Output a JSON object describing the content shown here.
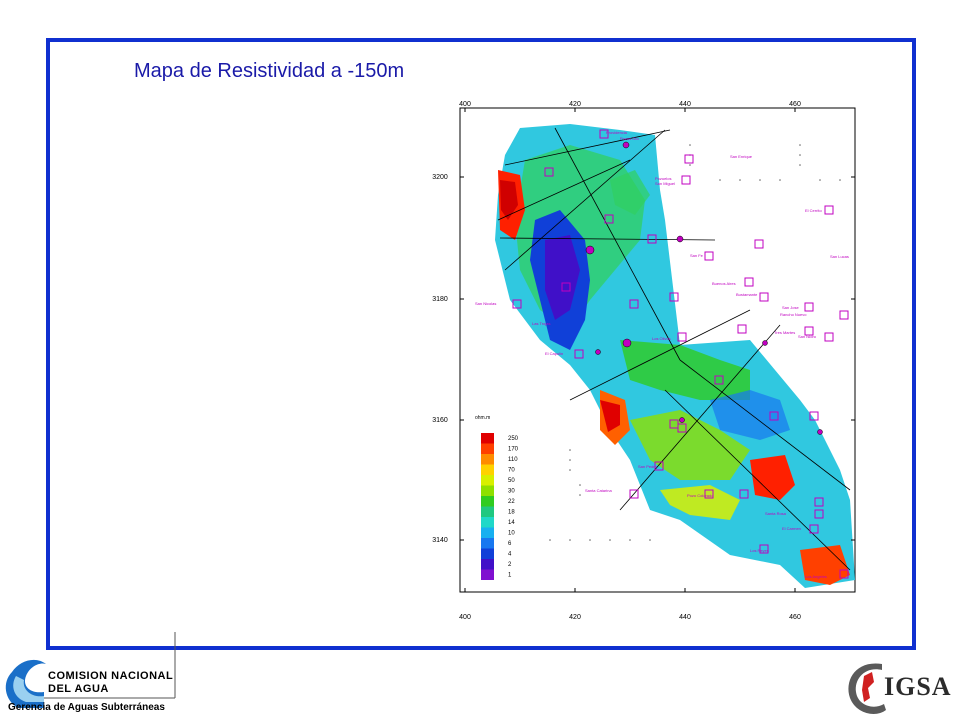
{
  "title": "Mapa de Resistividad a -150m",
  "map": {
    "x_ticks": [
      "400",
      "420",
      "440",
      "460"
    ],
    "y_ticks": [
      "3200",
      "3180",
      "3160",
      "3140"
    ],
    "legend": {
      "unit": "ohm.m",
      "values": [
        "250",
        "170",
        "110",
        "70",
        "50",
        "30",
        "22",
        "18",
        "14",
        "10",
        "6",
        "4",
        "2",
        "1"
      ],
      "colors": [
        "#e00000",
        "#ff4000",
        "#ff8c00",
        "#ffd200",
        "#d8f000",
        "#8fe000",
        "#30cc20",
        "#20c880",
        "#20d8c8",
        "#18b0f0",
        "#1878f0",
        "#1040d8",
        "#4010c8",
        "#8010d0"
      ]
    },
    "map_labels": [
      "Providencia",
      "Pozos Gto",
      "San Enrique",
      "Pozuelos",
      "San Miguel",
      "El Cerrito",
      "San Lucas",
      "San Fe",
      "Buenos Aires",
      "Bustamante",
      "San Jose",
      "Los Olivos",
      "El Capulin",
      "San Nicolas",
      "Tres Martes",
      "San Isidro",
      "Rancho Nuevo",
      "Santa Catarina",
      "Los Angeles",
      "El Carmen",
      "Santa Rosa",
      "Las Trojas",
      "San Pedro",
      "Pozo Colorado",
      "Los Reyes"
    ]
  },
  "org": {
    "line1": "COMISION NACIONAL",
    "line2": "DEL AGUA",
    "department": "Gerencia de Aguas Subterráneas"
  },
  "igsa": {
    "name": "IGSA"
  },
  "colors": {
    "frame": "#1030d0",
    "title": "#1a1aa8",
    "marker": "#c000c0"
  }
}
